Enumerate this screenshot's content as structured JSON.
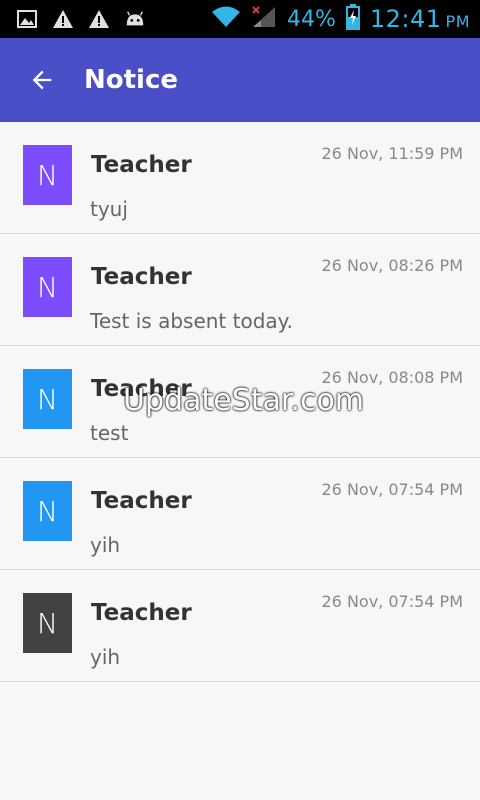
{
  "status_bar": {
    "battery_percent": "44%",
    "time": "12:41",
    "ampm": "PM",
    "icons": [
      "image-icon",
      "warning-icon",
      "warning-icon",
      "android-icon",
      "wifi-icon",
      "signal-icon",
      "battery-icon"
    ],
    "accent_color": "#33b5e5"
  },
  "app_bar": {
    "title": "Notice",
    "back_icon": "arrow-left-icon",
    "background_color": "#4a4fc7"
  },
  "notices": [
    {
      "avatar_letter": "N",
      "avatar_color": "#7c4dff",
      "sender": "Teacher",
      "timestamp": "26 Nov, 11:59 PM",
      "message": "tyuj"
    },
    {
      "avatar_letter": "N",
      "avatar_color": "#7c4dff",
      "sender": "Teacher",
      "timestamp": "26 Nov, 08:26 PM",
      "message": "Test is absent today."
    },
    {
      "avatar_letter": "N",
      "avatar_color": "#2196f3",
      "sender": "Teacher",
      "timestamp": "26 Nov, 08:08 PM",
      "message": "test"
    },
    {
      "avatar_letter": "N",
      "avatar_color": "#2196f3",
      "sender": "Teacher",
      "timestamp": "26 Nov, 07:54 PM",
      "message": "yih"
    },
    {
      "avatar_letter": "N",
      "avatar_color": "#424242",
      "sender": "Teacher",
      "timestamp": "26 Nov, 07:54 PM",
      "message": "yih"
    }
  ],
  "watermark": "UpdateStar.com"
}
